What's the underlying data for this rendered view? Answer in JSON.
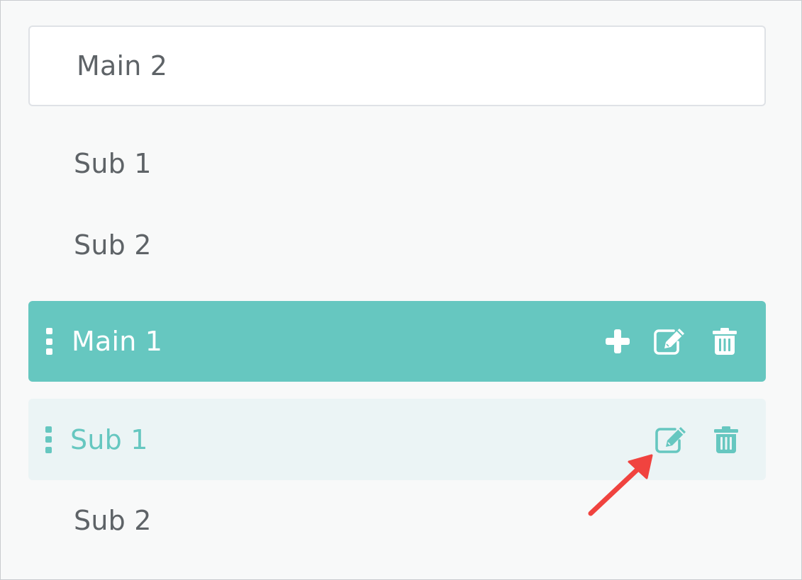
{
  "items": {
    "main2": {
      "label": "Main 2"
    },
    "sub1_a": {
      "label": "Sub 1"
    },
    "sub2_a": {
      "label": "Sub 2"
    },
    "main1": {
      "label": "Main 1"
    },
    "sub1_b": {
      "label": "Sub 1"
    },
    "sub2_b": {
      "label": "Sub 2"
    }
  },
  "icons": {
    "main1_actions": [
      "plus-icon",
      "edit-icon",
      "trash-icon"
    ],
    "sub1_actions": [
      "edit-icon",
      "trash-icon"
    ],
    "drag": "drag-handle-icon",
    "callout": "red-arrow-icon"
  },
  "colors": {
    "accent": "#66c7c0",
    "active_row_bg": "#ebf4f5",
    "text": "#5e6367",
    "arrow": "#f0433f",
    "page_bg": "#f8f9f9"
  }
}
